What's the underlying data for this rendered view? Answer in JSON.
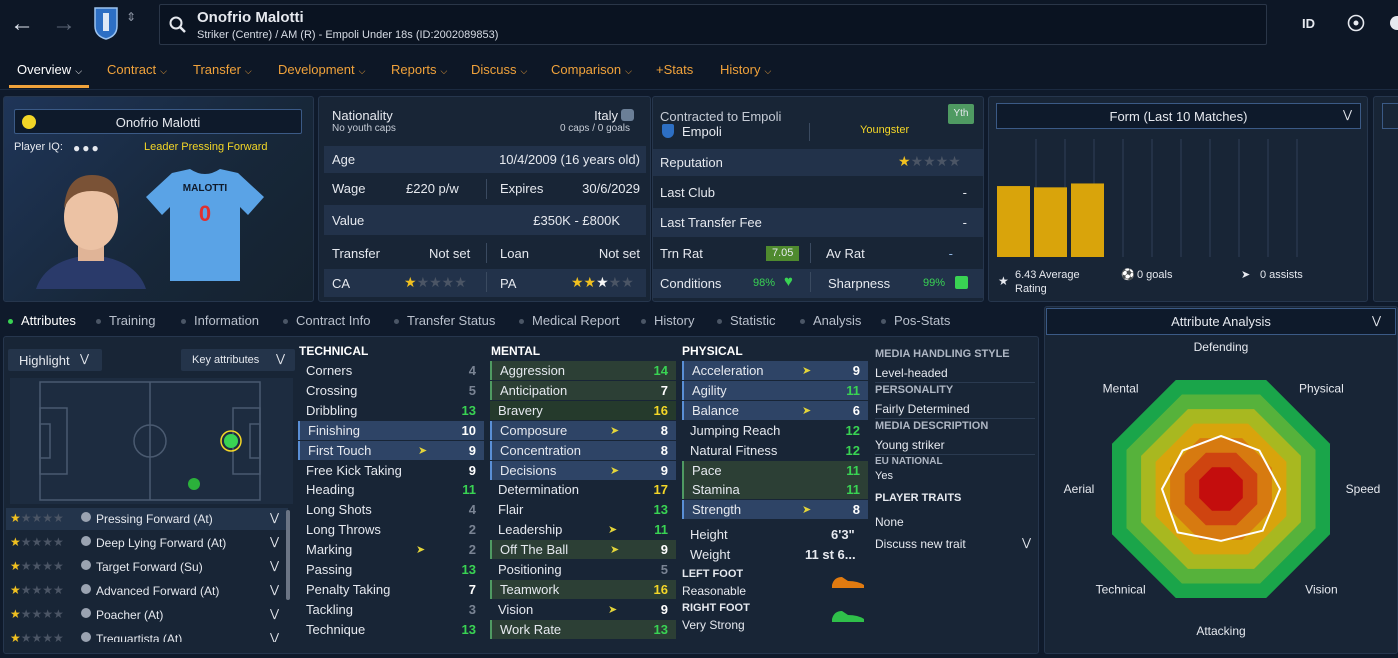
{
  "header": {
    "player_name": "Onofrio Malotti",
    "player_sub": "Striker (Centre) / AM (R) - Empoli Under 18s (ID:2002089853)",
    "id_label": "ID"
  },
  "tabs": [
    "Overview",
    "Contract",
    "Transfer",
    "Development",
    "Reports",
    "Discuss",
    "Comparison",
    "+Stats",
    "History"
  ],
  "profile": {
    "name": "Onofrio Malotti",
    "player_iq_label": "Player IQ:",
    "role_line": "Leader  Pressing Forward",
    "shirt_name": "MALOTTI",
    "shirt_number": "0"
  },
  "info": {
    "nationality_label": "Nationality",
    "nationality_value": "Italy",
    "youth_caps": "No youth caps",
    "caps": "0 caps / 0 goals",
    "age_label": "Age",
    "age_value": "10/4/2009 (16 years old)",
    "wage_label": "Wage",
    "wage_value": "£220 p/w",
    "expires_label": "Expires",
    "expires_value": "30/6/2029",
    "value_label": "Value",
    "value_value": "£350K - £800K",
    "transfer_label": "Transfer",
    "transfer_value": "Not set",
    "loan_label": "Loan",
    "loan_value": "Not set",
    "ca_label": "CA",
    "pa_label": "PA",
    "ca_stars": 1,
    "pa_stars": 2.5
  },
  "contract": {
    "contracted_label": "Contracted to Empoli",
    "club": "Empoli",
    "status": "Youngster",
    "badge": "Yth",
    "reputation_label": "Reputation",
    "last_club_label": "Last Club",
    "last_club_value": "-",
    "last_fee_label": "Last Transfer Fee",
    "last_fee_value": "-",
    "trn_rat_label": "Trn Rat",
    "trn_rat_value": "7.05",
    "av_rat_label": "Av Rat",
    "av_rat_value": "-",
    "conditions_label": "Conditions",
    "conditions_value": "98%",
    "sharpness_label": "Sharpness",
    "sharpness_value": "99%"
  },
  "form": {
    "title": "Form (Last 10 Matches)",
    "avg_rating": "6.43 Average Rating",
    "goals": "0 goals",
    "assists": "0 assists",
    "values": [
      6.4,
      6.3,
      6.6
    ]
  },
  "subtabs": [
    "Attributes",
    "Training",
    "Information",
    "Contract Info",
    "Transfer Status",
    "Medical Report",
    "History",
    "Statistic",
    "Analysis",
    "Pos-Stats"
  ],
  "pitch": {
    "highlight_label": "Highlight",
    "key_attr_label": "Key attributes"
  },
  "roles": [
    {
      "name": "Pressing Forward (At)"
    },
    {
      "name": "Deep Lying Forward (At)"
    },
    {
      "name": "Target Forward (Su)"
    },
    {
      "name": "Advanced Forward (At)"
    },
    {
      "name": "Poacher (At)"
    },
    {
      "name": "Trequartista (At)"
    }
  ],
  "technical": {
    "title": "TECHNICAL",
    "items": [
      {
        "n": "Corners",
        "v": "4"
      },
      {
        "n": "Crossing",
        "v": "5"
      },
      {
        "n": "Dribbling",
        "v": "13"
      },
      {
        "n": "Finishing",
        "v": "10"
      },
      {
        "n": "First Touch",
        "v": "9"
      },
      {
        "n": "Free Kick Taking",
        "v": "9"
      },
      {
        "n": "Heading",
        "v": "11"
      },
      {
        "n": "Long Shots",
        "v": "4"
      },
      {
        "n": "Long Throws",
        "v": "2"
      },
      {
        "n": "Marking",
        "v": "2"
      },
      {
        "n": "Passing",
        "v": "13"
      },
      {
        "n": "Penalty Taking",
        "v": "7"
      },
      {
        "n": "Tackling",
        "v": "3"
      },
      {
        "n": "Technique",
        "v": "13"
      }
    ]
  },
  "mental": {
    "title": "MENTAL",
    "items": [
      {
        "n": "Aggression",
        "v": "14"
      },
      {
        "n": "Anticipation",
        "v": "7"
      },
      {
        "n": "Bravery",
        "v": "16"
      },
      {
        "n": "Composure",
        "v": "8"
      },
      {
        "n": "Concentration",
        "v": "8"
      },
      {
        "n": "Decisions",
        "v": "9"
      },
      {
        "n": "Determination",
        "v": "17"
      },
      {
        "n": "Flair",
        "v": "13"
      },
      {
        "n": "Leadership",
        "v": "11"
      },
      {
        "n": "Off The Ball",
        "v": "9"
      },
      {
        "n": "Positioning",
        "v": "5"
      },
      {
        "n": "Teamwork",
        "v": "16"
      },
      {
        "n": "Vision",
        "v": "9"
      },
      {
        "n": "Work Rate",
        "v": "13"
      }
    ]
  },
  "physical": {
    "title": "PHYSICAL",
    "items": [
      {
        "n": "Acceleration",
        "v": "9"
      },
      {
        "n": "Agility",
        "v": "11"
      },
      {
        "n": "Balance",
        "v": "6"
      },
      {
        "n": "Jumping Reach",
        "v": "12"
      },
      {
        "n": "Natural Fitness",
        "v": "12"
      },
      {
        "n": "Pace",
        "v": "11"
      },
      {
        "n": "Stamina",
        "v": "11"
      },
      {
        "n": "Strength",
        "v": "8"
      }
    ],
    "height_label": "Height",
    "height_value": "6'3\"",
    "weight_label": "Weight",
    "weight_value": "11 st 6...",
    "left_foot_label": "LEFT FOOT",
    "left_foot_value": "Reasonable",
    "right_foot_label": "RIGHT FOOT",
    "right_foot_value": "Very Strong"
  },
  "media": {
    "style_label": "MEDIA HANDLING STYLE",
    "style_value": "Level-headed",
    "personality_label": "PERSONALITY",
    "personality_value": "Fairly Determined",
    "description_label": "MEDIA DESCRIPTION",
    "description_value": "Young striker",
    "eu_label": "EU NATIONAL",
    "eu_value": "Yes",
    "traits_label": "PLAYER TRAITS",
    "traits_value": "None",
    "discuss_label": "Discuss new trait"
  },
  "analysis": {
    "title": "Attribute Analysis",
    "axes": [
      "Defending",
      "Physical",
      "Speed",
      "Vision",
      "Attacking",
      "Technical",
      "Aerial",
      "Mental"
    ]
  },
  "colors": {
    "accent": "#f0a23b",
    "good": "#39d353",
    "warn": "#f3d627",
    "form_bar": "#d9a40b"
  }
}
